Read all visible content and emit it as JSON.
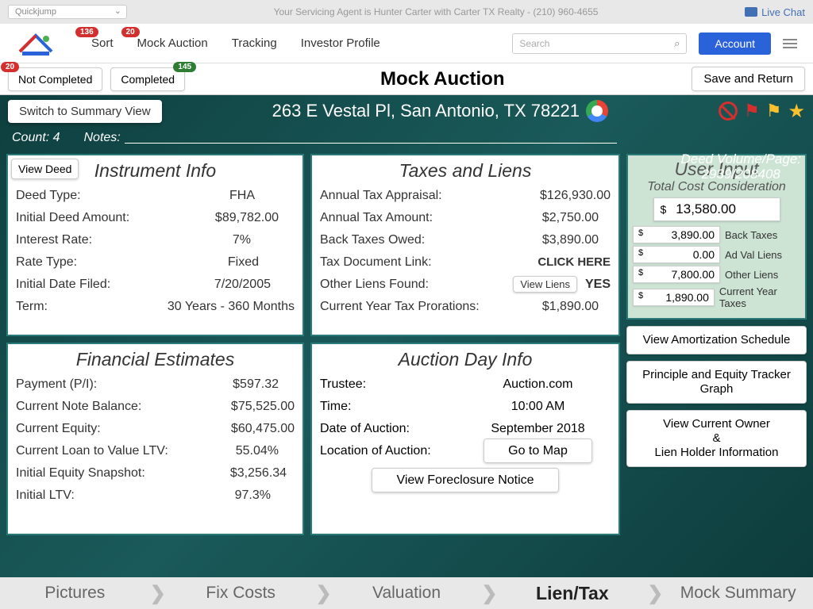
{
  "topbar": {
    "quickjump": "Quickjump",
    "agent": "Your Servicing Agent is Hunter Carter with Carter TX Realty - (210) 960-4655",
    "livechat": "Live Chat"
  },
  "nav": {
    "sort": "Sort",
    "sort_badge": "136",
    "mock": "Mock Auction",
    "mock_badge": "20",
    "tracking": "Tracking",
    "investor": "Investor Profile",
    "search_placeholder": "Search",
    "account": "Account"
  },
  "status": {
    "not_completed": "Not Completed",
    "not_completed_badge": "20",
    "completed": "Completed",
    "completed_badge": "145",
    "title": "Mock Auction",
    "save": "Save and Return"
  },
  "address_section": {
    "switch": "Switch to Summary View",
    "address": "263 E Vestal Pl, San Antonio, TX 78221"
  },
  "notes": {
    "count": "Count: 4",
    "label": "Notes:",
    "deed_vol_label": "Deed Volume/Page:",
    "deed_vol_value": "2939/208408"
  },
  "instrument": {
    "title": "Instrument Info",
    "view_deed": "View Deed",
    "deed_type_l": "Deed Type:",
    "deed_type_v": "FHA",
    "initial_amt_l": "Initial Deed Amount:",
    "initial_amt_v": "$89,782.00",
    "rate_l": "Interest Rate:",
    "rate_v": "7%",
    "rate_type_l": "Rate Type:",
    "rate_type_v": "Fixed",
    "date_l": "Initial Date Filed:",
    "date_v": "7/20/2005",
    "term_l": "Term:",
    "term_v": "30 Years - 360 Months"
  },
  "financial": {
    "title": "Financial Estimates",
    "payment_l": "Payment (P/I):",
    "payment_v": "$597.32",
    "balance_l": "Current Note Balance:",
    "balance_v": "$75,525.00",
    "equity_l": "Current Equity:",
    "equity_v": "$60,475.00",
    "ltv_l": "Current Loan to Value LTV:",
    "ltv_v": "55.04%",
    "snap_l": "Initial Equity Snapshot:",
    "snap_v": "$3,256.34",
    "iltv_l": "Initial LTV:",
    "iltv_v": "97.3%"
  },
  "taxes": {
    "title": "Taxes and Liens",
    "appraisal_l": "Annual Tax Appraisal:",
    "appraisal_v": "$126,930.00",
    "annual_l": "Annual Tax Amount:",
    "annual_v": "$2,750.00",
    "back_l": "Back Taxes Owed:",
    "back_v": "$3,890.00",
    "doc_l": "Tax Document Link:",
    "doc_v": "CLICK HERE",
    "other_l": "Other Liens Found:",
    "view_liens": "View Liens",
    "other_v": "YES",
    "pro_l": "Current Year Tax Prorations:",
    "pro_v": "$1,890.00"
  },
  "auction": {
    "title": "Auction Day Info",
    "trustee_l": "Trustee:",
    "trustee_v": "Auction.com",
    "time_l": "Time:",
    "time_v": "10:00 AM",
    "date_l": "Date of Auction:",
    "date_v": "September 2018",
    "loc_l": "Location of Auction:",
    "map": "Go to Map",
    "foreclosure": "View Foreclosure Notice"
  },
  "user": {
    "title": "User Input",
    "sub": "Total Cost Consideration",
    "total": "13,580.00",
    "back_taxes_v": "3,890.00",
    "back_taxes_l": "Back Taxes",
    "adval_v": "0.00",
    "adval_l": "Ad Val Liens",
    "other_v": "7,800.00",
    "other_l": "Other Liens",
    "cy_v": "1,890.00",
    "cy_l": "Current Year Taxes"
  },
  "side_buttons": {
    "amort": "View Amortization Schedule",
    "tracker": "Principle and Equity Tracker Graph",
    "owner": "View Current Owner\n&\nLien Holder Information"
  },
  "tabs": {
    "pictures": "Pictures",
    "fix": "Fix Costs",
    "valuation": "Valuation",
    "lien": "Lien/Tax",
    "summary": "Mock Summary"
  }
}
